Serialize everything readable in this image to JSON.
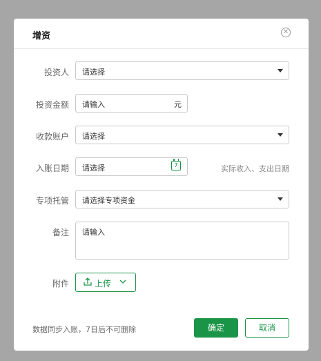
{
  "dialog": {
    "title": "增资"
  },
  "form": {
    "investor": {
      "label": "投资人",
      "placeholder": "请选择"
    },
    "amount": {
      "label": "投资金额",
      "placeholder": "请输入",
      "unit": "元"
    },
    "account": {
      "label": "收款账户",
      "placeholder": "请选择"
    },
    "date": {
      "label": "入账日期",
      "placeholder": "请选择",
      "calendar_day": "7",
      "hint": "实际收入、支出日期"
    },
    "custody": {
      "label": "专项托管",
      "placeholder": "请选择专项资金"
    },
    "remark": {
      "label": "备注",
      "placeholder": "请输入"
    },
    "attachment": {
      "label": "附件",
      "upload_label": "上传"
    }
  },
  "footer": {
    "note": "数据同步入账，7日后不可删除",
    "confirm_label": "确定",
    "cancel_label": "取消"
  },
  "colors": {
    "accent": "#1a9447",
    "overlay": "#a6a6a6"
  },
  "icons": {
    "close": "close-icon",
    "calendar": "calendar-icon",
    "upload": "upload-icon",
    "dropdown": "chevron-down-icon"
  }
}
